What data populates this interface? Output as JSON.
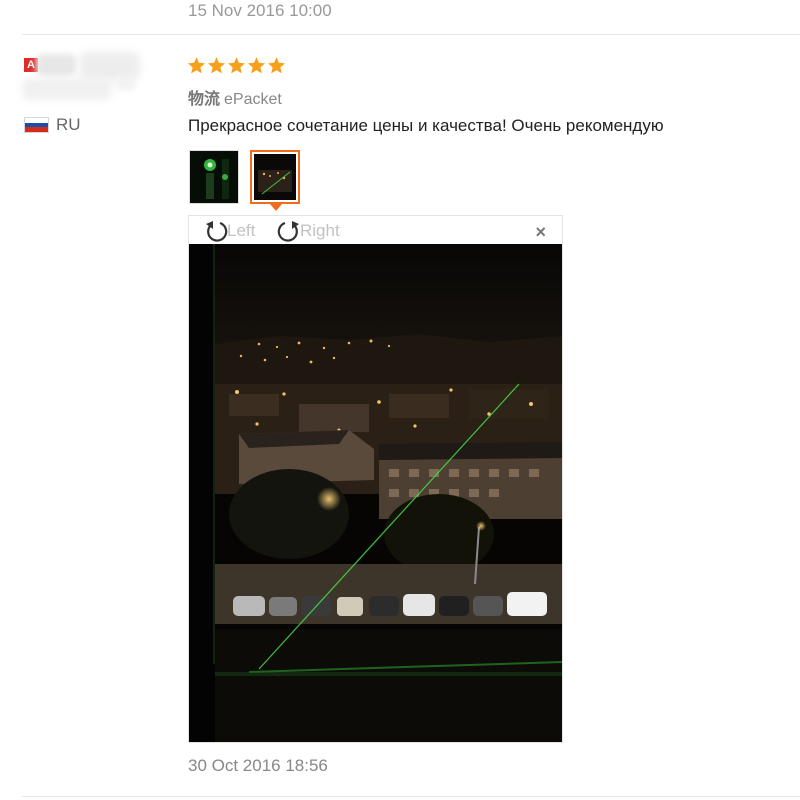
{
  "previous_review": {
    "date": "15 Nov 2016 10:00"
  },
  "buyer": {
    "country_code": "RU",
    "flag_colors": [
      "#ffffff",
      "#1c4ea3",
      "#d52b1e"
    ]
  },
  "review": {
    "rating": 5,
    "rating_max": 5,
    "star_color": "#f7a01c",
    "shipping_label": "物流",
    "shipping_method": "ePacket",
    "text": "Прекрасное сочетание цены и качества! Очень рекомендую",
    "date": "30 Oct 2016 18:56",
    "photos": [
      {
        "name": "photo-1-green-laser"
      },
      {
        "name": "photo-2-night-city",
        "selected": true
      }
    ]
  },
  "viewer": {
    "rotate_left_label": "Left",
    "rotate_right_label": "Right",
    "close_symbol": "×",
    "accent_color": "#f26c1e"
  }
}
